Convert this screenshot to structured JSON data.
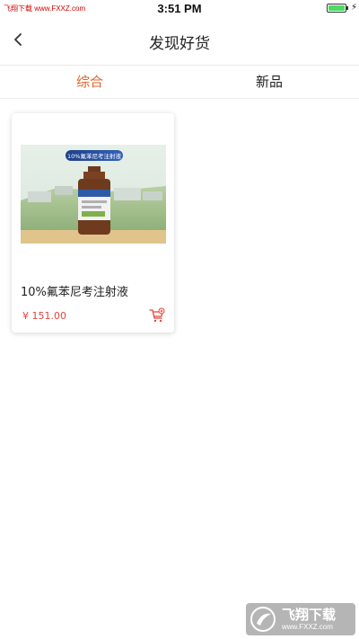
{
  "status_bar": {
    "carrier": "飞翔下载 www.FXXZ.com",
    "time": "3:51 PM",
    "battery_level": 1.0,
    "charging_icon": "lightning-bolt-icon"
  },
  "nav": {
    "back_icon": "chevron-left-icon",
    "title": "发现好货"
  },
  "tabs": [
    {
      "label": "综合",
      "active": true
    },
    {
      "label": "新品",
      "active": false
    }
  ],
  "products": [
    {
      "name": "10%氟苯尼考注射液",
      "price": "¥ 151.00",
      "image_label": "10%氟苯尼考注射液",
      "cart_icon": "add-to-cart-icon"
    }
  ],
  "watermark": {
    "title": "飞翔下载",
    "url": "www.FXXZ.com"
  },
  "colors": {
    "accent": "#e0632c",
    "price": "#e0463c",
    "battery": "#4cd964"
  }
}
